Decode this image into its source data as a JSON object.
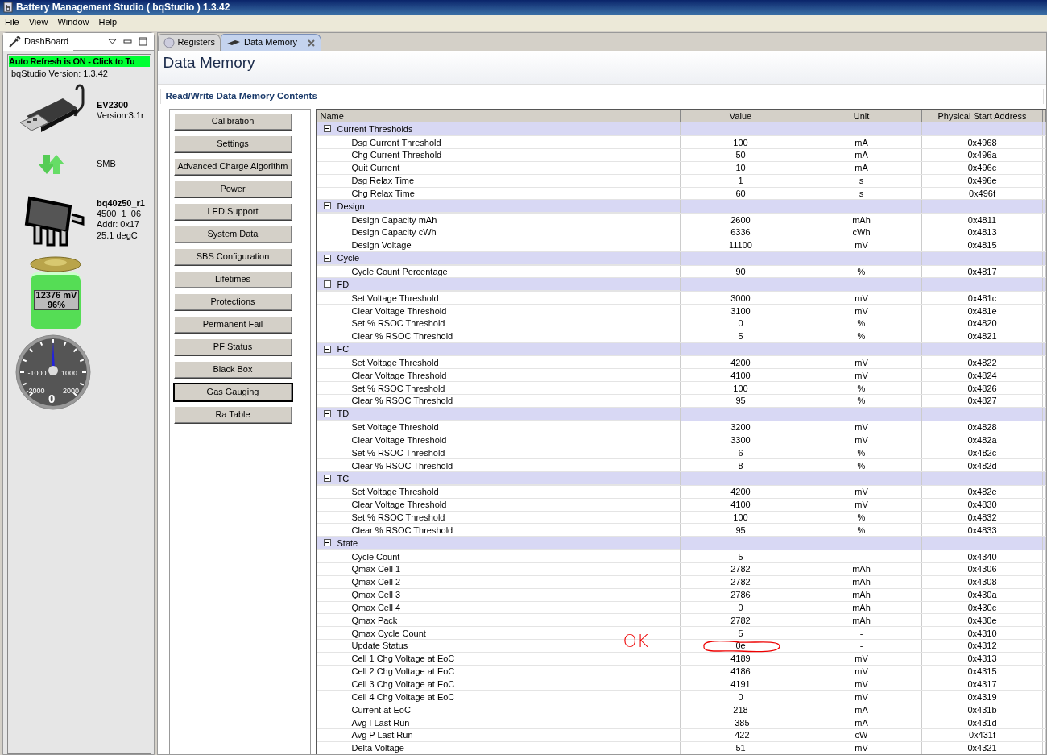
{
  "window": {
    "title": "Battery Management Studio ( bqStudio ) 1.3.42"
  },
  "menu": [
    "File",
    "View",
    "Window",
    "Help"
  ],
  "dashboard": {
    "tab": "DashBoard",
    "auto_refresh": "Auto Refresh is ON - Click to Tu",
    "version": "bqStudio Version:  1.3.42",
    "adapter": {
      "name": "EV2300",
      "detail": "Version:3.1r"
    },
    "bus": "SMB",
    "device": {
      "name": "bq40z50_r1",
      "lines": [
        "4500_1_06",
        "Addr: 0x17",
        "25.1 degC"
      ]
    },
    "battery": {
      "voltage": "12376 mV",
      "percent": "96%",
      "level": 0.96
    },
    "gauge": {
      "labels": [
        "-1000",
        "1000",
        "-2000",
        "2000"
      ],
      "reading": "0"
    }
  },
  "editor_tabs": [
    {
      "label": "Registers",
      "selected": false,
      "closable": false
    },
    {
      "label": "Data Memory",
      "selected": true,
      "closable": true
    }
  ],
  "page_title": "Data Memory",
  "section_title": "Read/Write Data Memory Contents",
  "categories": [
    {
      "label": "Calibration",
      "selected": false
    },
    {
      "label": "Settings",
      "selected": false
    },
    {
      "label": "Advanced Charge Algorithm",
      "selected": false
    },
    {
      "label": "Power",
      "selected": false
    },
    {
      "label": "LED Support",
      "selected": false
    },
    {
      "label": "System Data",
      "selected": false
    },
    {
      "label": "SBS Configuration",
      "selected": false
    },
    {
      "label": "Lifetimes",
      "selected": false
    },
    {
      "label": "Protections",
      "selected": false
    },
    {
      "label": "Permanent Fail",
      "selected": false
    },
    {
      "label": "PF Status",
      "selected": false
    },
    {
      "label": "Black Box",
      "selected": false
    },
    {
      "label": "Gas Gauging",
      "selected": true
    },
    {
      "label": "Ra Table",
      "selected": false
    }
  ],
  "table": {
    "columns": [
      "Name",
      "Value",
      "Unit",
      "Physical Start Address"
    ],
    "groups": [
      {
        "name": "Current Thresholds",
        "expanded": true,
        "children": [
          [
            "Dsg Current Threshold",
            "100",
            "mA",
            "0x4968"
          ],
          [
            "Chg Current Threshold",
            "50",
            "mA",
            "0x496a"
          ],
          [
            "Quit Current",
            "10",
            "mA",
            "0x496c"
          ],
          [
            "Dsg Relax Time",
            "1",
            "s",
            "0x496e"
          ],
          [
            "Chg Relax Time",
            "60",
            "s",
            "0x496f"
          ]
        ]
      },
      {
        "name": "Design",
        "expanded": true,
        "children": [
          [
            "Design Capacity mAh",
            "2600",
            "mAh",
            "0x4811"
          ],
          [
            "Design Capacity cWh",
            "6336",
            "cWh",
            "0x4813"
          ],
          [
            "Design Voltage",
            "11100",
            "mV",
            "0x4815"
          ]
        ]
      },
      {
        "name": "Cycle",
        "expanded": true,
        "children": [
          [
            "Cycle Count Percentage",
            "90",
            "%",
            "0x4817"
          ]
        ]
      },
      {
        "name": "FD",
        "expanded": true,
        "children": [
          [
            "Set Voltage Threshold",
            "3000",
            "mV",
            "0x481c"
          ],
          [
            "Clear Voltage Threshold",
            "3100",
            "mV",
            "0x481e"
          ],
          [
            "Set % RSOC Threshold",
            "0",
            "%",
            "0x4820"
          ],
          [
            "Clear % RSOC Threshold",
            "5",
            "%",
            "0x4821"
          ]
        ]
      },
      {
        "name": "FC",
        "expanded": true,
        "children": [
          [
            "Set Voltage Threshold",
            "4200",
            "mV",
            "0x4822"
          ],
          [
            "Clear Voltage Threshold",
            "4100",
            "mV",
            "0x4824"
          ],
          [
            "Set % RSOC Threshold",
            "100",
            "%",
            "0x4826"
          ],
          [
            "Clear % RSOC Threshold",
            "95",
            "%",
            "0x4827"
          ]
        ]
      },
      {
        "name": "TD",
        "expanded": true,
        "children": [
          [
            "Set Voltage Threshold",
            "3200",
            "mV",
            "0x4828"
          ],
          [
            "Clear Voltage Threshold",
            "3300",
            "mV",
            "0x482a"
          ],
          [
            "Set % RSOC Threshold",
            "6",
            "%",
            "0x482c"
          ],
          [
            "Clear % RSOC Threshold",
            "8",
            "%",
            "0x482d"
          ]
        ]
      },
      {
        "name": "TC",
        "expanded": true,
        "children": [
          [
            "Set Voltage Threshold",
            "4200",
            "mV",
            "0x482e"
          ],
          [
            "Clear Voltage Threshold",
            "4100",
            "mV",
            "0x4830"
          ],
          [
            "Set % RSOC Threshold",
            "100",
            "%",
            "0x4832"
          ],
          [
            "Clear % RSOC Threshold",
            "95",
            "%",
            "0x4833"
          ]
        ]
      },
      {
        "name": "State",
        "expanded": true,
        "children": [
          [
            "Cycle Count",
            "5",
            "-",
            "0x4340"
          ],
          [
            "Qmax Cell 1",
            "2782",
            "mAh",
            "0x4306"
          ],
          [
            "Qmax Cell 2",
            "2782",
            "mAh",
            "0x4308"
          ],
          [
            "Qmax Cell 3",
            "2786",
            "mAh",
            "0x430a"
          ],
          [
            "Qmax Cell 4",
            "0",
            "mAh",
            "0x430c"
          ],
          [
            "Qmax Pack",
            "2782",
            "mAh",
            "0x430e"
          ],
          [
            "Qmax Cycle Count",
            "5",
            "-",
            "0x4310"
          ],
          [
            "Update Status",
            "0e",
            "-",
            "0x4312"
          ],
          [
            "Cell 1 Chg Voltage at EoC",
            "4189",
            "mV",
            "0x4313"
          ],
          [
            "Cell 2 Chg Voltage at EoC",
            "4186",
            "mV",
            "0x4315"
          ],
          [
            "Cell 3 Chg Voltage at EoC",
            "4191",
            "mV",
            "0x4317"
          ],
          [
            "Cell 4 Chg Voltage at EoC",
            "0",
            "mV",
            "0x4319"
          ],
          [
            "Current at EoC",
            "218",
            "mA",
            "0x431b"
          ],
          [
            "Avg I Last Run",
            "-385",
            "mA",
            "0x431d"
          ],
          [
            "Avg P Last Run",
            "-422",
            "cW",
            "0x431f"
          ],
          [
            "Delta Voltage",
            "51",
            "mV",
            "0x4321"
          ]
        ]
      }
    ]
  },
  "annotations": [
    {
      "kind": "text",
      "text": "OK"
    },
    {
      "kind": "ellipse"
    }
  ]
}
